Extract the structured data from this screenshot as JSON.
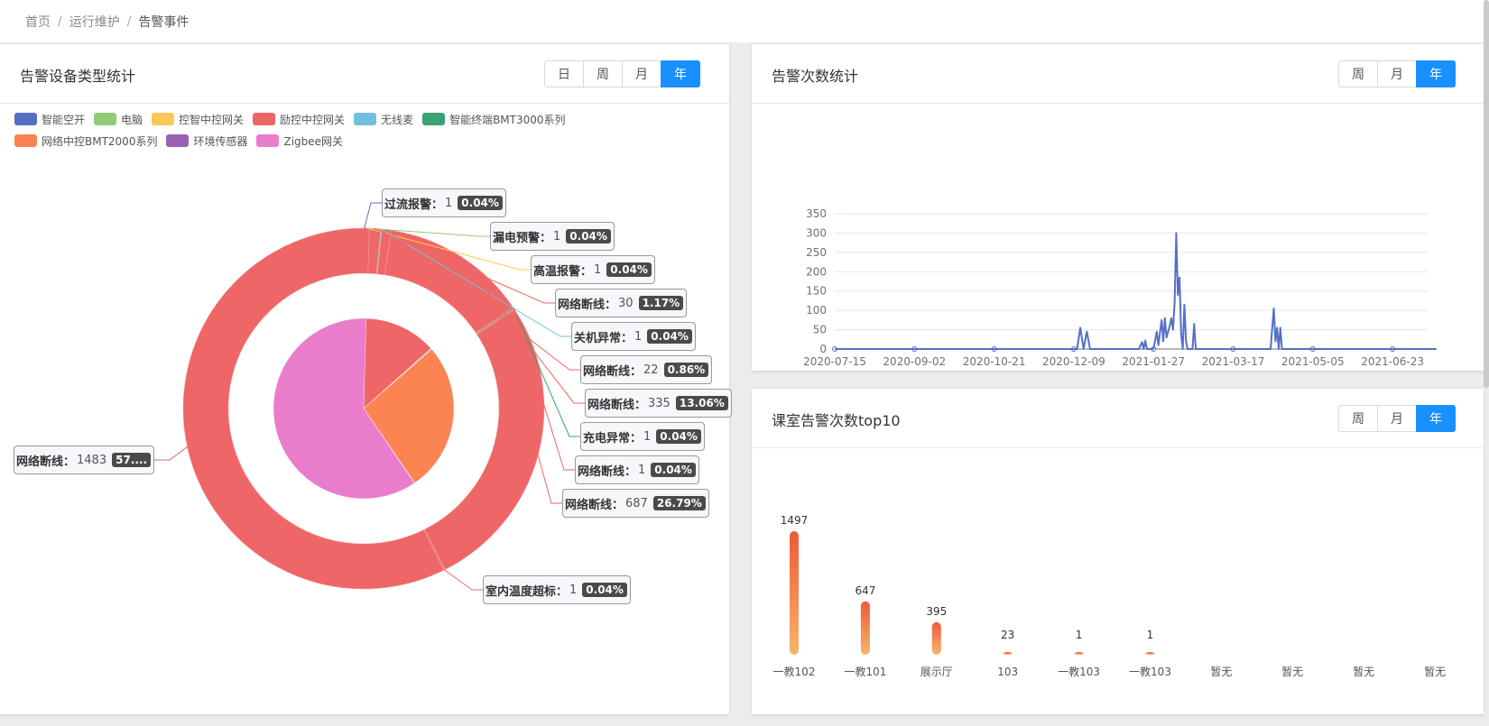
{
  "breadcrumb": {
    "home": "首页",
    "level2": "运行维护",
    "current": "告警事件"
  },
  "left_panel": {
    "title": "告警设备类型统计",
    "buttons": [
      "日",
      "周",
      "月",
      "年"
    ],
    "active": "年",
    "legend": [
      {
        "name": "智能空开",
        "color": "#5470c6"
      },
      {
        "name": "电脑",
        "color": "#91cc75"
      },
      {
        "name": "控智中控网关",
        "color": "#fac858"
      },
      {
        "name": "励控中控网关",
        "color": "#ee6666"
      },
      {
        "name": "无线麦",
        "color": "#73c0de"
      },
      {
        "name": "智能终端BMT3000系列",
        "color": "#3ba272"
      },
      {
        "name": "网络中控BMT2000系列",
        "color": "#fc8452"
      },
      {
        "name": "环境传感器",
        "color": "#9a60b4"
      },
      {
        "name": "Zigbee网关",
        "color": "#ea7ccc"
      }
    ],
    "chart_data": {
      "type": "pie",
      "inner_series": [
        {
          "name": "智能空开",
          "value": 1,
          "color": "#5470c6"
        },
        {
          "name": "电脑",
          "value": 1,
          "color": "#91cc75"
        },
        {
          "name": "控智中控网关",
          "value": 1,
          "color": "#fac858"
        },
        {
          "name": "励控中控网关",
          "value": 335,
          "color": "#ee6666"
        },
        {
          "name": "无线麦",
          "value": 1,
          "color": "#73c0de"
        },
        {
          "name": "智能终端BMT3000系列",
          "value": 1,
          "color": "#3ba272"
        },
        {
          "name": "网络中控BMT2000系列",
          "value": 687,
          "color": "#fc8452"
        },
        {
          "name": "环境传感器",
          "value": 1,
          "color": "#9a60b4"
        },
        {
          "name": "Zigbee网关",
          "value": 1537,
          "color": "#ea7ccc"
        }
      ],
      "outer_series": [
        {
          "name": "过流报警",
          "value": 1,
          "percent": "0.04%",
          "color": "#5470c6"
        },
        {
          "name": "漏电预警",
          "value": 1,
          "percent": "0.04%",
          "color": "#91cc75"
        },
        {
          "name": "高温报警",
          "value": 1,
          "percent": "0.04%",
          "color": "#fac858"
        },
        {
          "name": "网络断线",
          "value": 30,
          "percent": "1.17%",
          "color": "#ee6666"
        },
        {
          "name": "关机异常",
          "value": 1,
          "percent": "0.04%",
          "color": "#73c0de"
        },
        {
          "name": "网络断线",
          "value": 22,
          "percent": "0.86%",
          "color": "#ee6666"
        },
        {
          "name": "网络断线",
          "value": 335,
          "percent": "13.06%",
          "color": "#ee6666"
        },
        {
          "name": "充电异常",
          "value": 1,
          "percent": "0.04%",
          "color": "#3ba272"
        },
        {
          "name": "网络断线",
          "value": 1,
          "percent": "0.04%",
          "color": "#ee6666"
        },
        {
          "name": "网络断线",
          "value": 687,
          "percent": "26.79%",
          "color": "#ee6666"
        },
        {
          "name": "室内温度超标",
          "value": 1,
          "percent": "0.04%",
          "color": "#ee6666"
        },
        {
          "name": "网络断线",
          "value": 1483,
          "percent": "57....",
          "color": "#ee6666"
        }
      ]
    }
  },
  "line_panel": {
    "title": "告警次数统计",
    "buttons": [
      "周",
      "月",
      "年"
    ],
    "active": "年",
    "chart_data": {
      "type": "line",
      "x_tick_labels": [
        "2020-07-15",
        "2020-09-02",
        "2020-10-21",
        "2020-12-09",
        "2021-01-27",
        "2021-03-17",
        "2021-05-05",
        "2021-06-23"
      ],
      "y_ticks": [
        0,
        50,
        100,
        150,
        200,
        250,
        300,
        350
      ],
      "ylim": [
        0,
        350
      ],
      "series": [
        {
          "color": "#5470c6",
          "points": [
            [
              "2020-07-15",
              0
            ],
            [
              "2020-12-11",
              0
            ],
            [
              "2020-12-13",
              55
            ],
            [
              "2020-12-15",
              0
            ],
            [
              "2020-12-17",
              45
            ],
            [
              "2020-12-19",
              0
            ],
            [
              "2021-01-18",
              0
            ],
            [
              "2021-01-20",
              18
            ],
            [
              "2021-01-21",
              0
            ],
            [
              "2021-01-22",
              22
            ],
            [
              "2021-01-23",
              0
            ],
            [
              "2021-01-27",
              0
            ],
            [
              "2021-01-29",
              45
            ],
            [
              "2021-01-30",
              10
            ],
            [
              "2021-02-01",
              75
            ],
            [
              "2021-02-02",
              20
            ],
            [
              "2021-02-03",
              80
            ],
            [
              "2021-02-04",
              30
            ],
            [
              "2021-02-06",
              60
            ],
            [
              "2021-02-07",
              80
            ],
            [
              "2021-02-08",
              50
            ],
            [
              "2021-02-09",
              120
            ],
            [
              "2021-02-10",
              300
            ],
            [
              "2021-02-11",
              140
            ],
            [
              "2021-02-12",
              185
            ],
            [
              "2021-02-13",
              40
            ],
            [
              "2021-02-14",
              0
            ],
            [
              "2021-02-15",
              115
            ],
            [
              "2021-02-16",
              20
            ],
            [
              "2021-02-17",
              0
            ],
            [
              "2021-02-20",
              0
            ],
            [
              "2021-02-21",
              65
            ],
            [
              "2021-02-22",
              0
            ],
            [
              "2021-04-09",
              0
            ],
            [
              "2021-04-11",
              105
            ],
            [
              "2021-04-12",
              20
            ],
            [
              "2021-04-13",
              55
            ],
            [
              "2021-04-14",
              0
            ],
            [
              "2021-04-15",
              55
            ],
            [
              "2021-04-16",
              0
            ],
            [
              "2021-07-20",
              0
            ]
          ]
        }
      ]
    }
  },
  "bar_panel": {
    "title": "课室告警次数top10",
    "buttons": [
      "周",
      "月",
      "年"
    ],
    "active": "年",
    "chart_data": {
      "type": "bar",
      "categories": [
        "一教102",
        "一教101",
        "展示厅",
        "103",
        "一教103",
        "一教103",
        "暂无",
        "暂无",
        "暂无",
        "暂无"
      ],
      "values": [
        1497,
        647,
        395,
        23,
        1,
        1,
        null,
        null,
        null,
        null
      ],
      "value_labels": [
        "1497",
        "647",
        "395",
        "23",
        "1",
        "1",
        "",
        "",
        "",
        ""
      ],
      "gradient": [
        "#ee5a3a",
        "#f7b56b"
      ]
    }
  }
}
